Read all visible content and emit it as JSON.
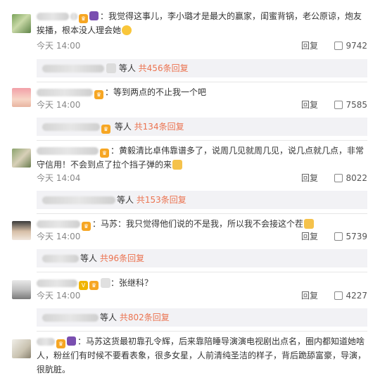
{
  "comments": [
    {
      "text": "：我觉得这事儿，李小璐才是最大的赢家，闺蜜背锅，老公原谅，炮友挨播，根本没人理会她",
      "time": "今天 14:00",
      "reply_label": "回复",
      "likes": "9742",
      "more_suffix": "等人",
      "more_link": "共456条回复"
    },
    {
      "text": "：等到两点的不止我一个吧",
      "time": "今天 14:00",
      "reply_label": "回复",
      "likes": "7585",
      "more_suffix": "等人",
      "more_link": "共134条回复"
    },
    {
      "text": "：黄毅清比卓伟靠谱多了，说周几见就周几见，说几点就几点，非常守信用！不会到点了拉个挡子弹的来",
      "time": "今天 14:04",
      "reply_label": "回复",
      "likes": "8022",
      "more_suffix": "等人",
      "more_link": "共153条回复"
    },
    {
      "text": "：马苏：我只觉得他们说的不是我，所以我不会接这个茬",
      "time": "今天 14:00",
      "reply_label": "回复",
      "likes": "5739",
      "more_suffix": "等人",
      "more_link": "共96条回复"
    },
    {
      "text": "：张继科？",
      "time": "今天 14:00",
      "reply_label": "回复",
      "likes": "4227",
      "more_suffix": "等人",
      "more_link": "共802条回复"
    },
    {
      "text": "：马苏这货最初靠孔令辉，后来靠陪睡导演演电视剧出点名，圈内都知道她啥人，粉丝们有时候不要看表象，很多女星，人前清纯圣洁的样子，背后跪舔富豪，导演，很肮脏。"
    }
  ],
  "colors": {
    "link": "#eb7350",
    "subbar_bg": "#f2f2f5",
    "text": "#333333",
    "meta": "#888888"
  },
  "icons": {
    "like": "thumbs-up-icon",
    "badge_crown": "crown-badge-icon",
    "badge_member": "member-badge-icon",
    "emoji_smile": "smile-emoji-icon",
    "emoji_cat": "cat-emoji-icon",
    "emoji_panda": "panda-emoji-icon"
  }
}
